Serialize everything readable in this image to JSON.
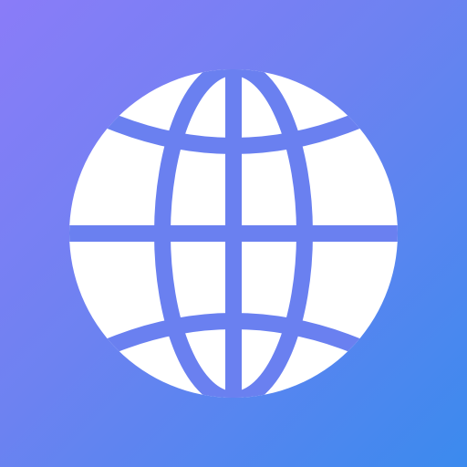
{
  "icon": {
    "name": "globe-icon",
    "colors": {
      "gradient_start": "#8a7cf8",
      "gradient_mid": "#6d82f1",
      "gradient_end": "#3b8aee",
      "glyph": "#ffffff"
    }
  }
}
